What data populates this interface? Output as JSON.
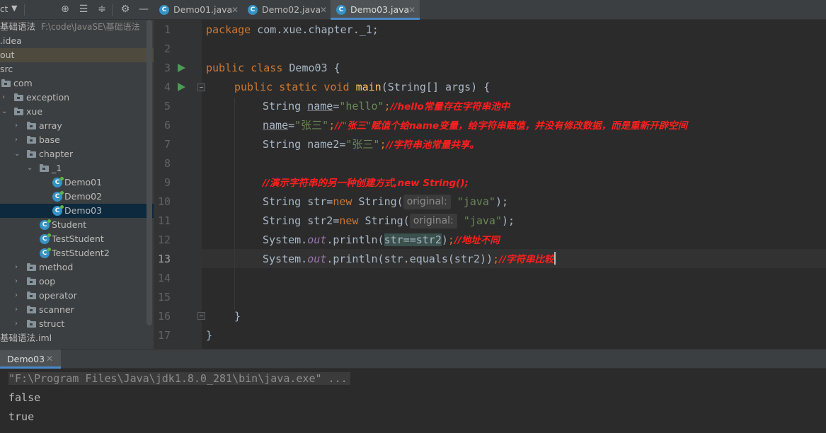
{
  "project_panel": {
    "title": "ct",
    "tree": [
      {
        "label": "基础语法",
        "path": "F:\\code\\JavaSE\\基础语法"
      },
      {
        "label": ".idea"
      },
      {
        "label": "out"
      },
      {
        "label": "src"
      },
      {
        "label": "com"
      },
      {
        "label": "exception"
      },
      {
        "label": "xue"
      },
      {
        "label": "array"
      },
      {
        "label": "base"
      },
      {
        "label": "chapter"
      },
      {
        "label": "_1"
      },
      {
        "label": "Demo01"
      },
      {
        "label": "Demo02"
      },
      {
        "label": "Demo03"
      },
      {
        "label": "Student"
      },
      {
        "label": "TestStudent"
      },
      {
        "label": "TestStudent2"
      },
      {
        "label": "method"
      },
      {
        "label": "oop"
      },
      {
        "label": "operator"
      },
      {
        "label": "scanner"
      },
      {
        "label": "struct"
      },
      {
        "label": "基础语法.iml"
      }
    ]
  },
  "tabs": [
    {
      "label": "Demo01.java"
    },
    {
      "label": "Demo02.java"
    },
    {
      "label": "Demo03.java",
      "active": true
    }
  ],
  "editor": {
    "line_numbers": [
      "1",
      "2",
      "3",
      "4",
      "5",
      "6",
      "7",
      "8",
      "9",
      "10",
      "11",
      "12",
      "13",
      "14",
      "15",
      "16",
      "17"
    ],
    "current_line": "13",
    "tokens": {
      "l1_kw": "package",
      "l1_rest": " com.xue.chapter._1;",
      "l3_kw": "public class",
      "l3_rest": " Demo03 {",
      "l4_kw": "public static void",
      "l4_fn": "main",
      "l4_rest": "(String[] args) {",
      "l5_type": "String ",
      "l5_var": "name",
      "l5_eq": "=",
      "l5_str": "\"hello\"",
      "l5_semi": ";",
      "l5_cm": "//hello常量存在字符串池中",
      "l6_var": "name",
      "l6_eq": "=",
      "l6_str": "\"张三\"",
      "l6_semi": ";",
      "l6_cm": "//\"张三\"赋值个给name变量，给字符串赋值，并没有修改数据，而是重新开辟空间",
      "l7_type": "String name2=",
      "l7_str": "\"张三\"",
      "l7_semi": ";",
      "l7_cm": "//字符串池常量共享。",
      "l9_cm": "//演示字符串的另一种创建方式,new String();",
      "l10_a": "String str=",
      "l10_kw": "new",
      "l10_b": " String(",
      "l10_hint": "original:",
      "l10_str": "\"java\"",
      "l10_c": ");",
      "l11_a": "String str2=",
      "l11_kw": "new",
      "l11_b": " String(",
      "l11_hint": "original:",
      "l11_str": "\"java\"",
      "l11_c": ");",
      "l12_a": "System.",
      "l12_out": "out",
      "l12_b": ".println(",
      "l12_match": "str==str2",
      "l12_c": ")",
      "l12_semi": ";",
      "l12_cm": "//地址不同",
      "l13_a": "System.",
      "l13_out": "out",
      "l13_b": ".println(str.equals(str2))",
      "l13_semi": ";",
      "l13_cm": "//字符串比较",
      "l16": "}",
      "l17": "}"
    }
  },
  "run_panel": {
    "tab_label": "Demo03",
    "console": [
      "\"F:\\Program Files\\Java\\jdk1.8.0_281\\bin\\java.exe\" ...",
      "false",
      "true"
    ]
  },
  "colors": {
    "keyword": "#cc7832",
    "string": "#6a8759",
    "comment": "#ff1f1f",
    "method": "#ffc66d",
    "static_field": "#9876aa",
    "text": "#a9b7c6",
    "accent": "#4a88c7"
  }
}
